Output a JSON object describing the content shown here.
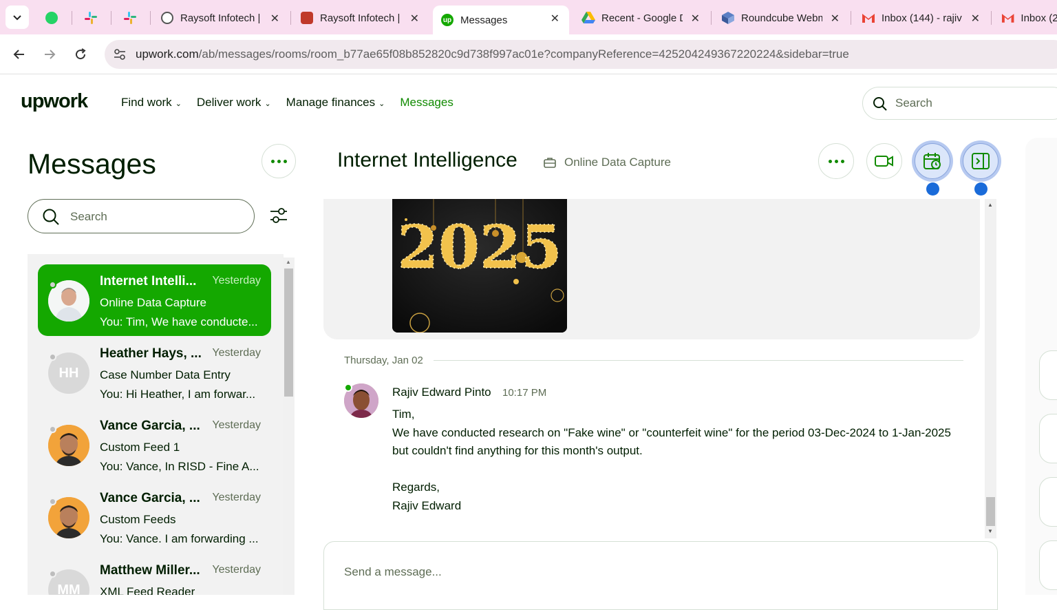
{
  "browser": {
    "tabs": [
      {
        "title": "",
        "favicon": "whatsapp-icon"
      },
      {
        "title": "",
        "favicon": "slack-icon"
      },
      {
        "title": "",
        "favicon": "slack-icon"
      },
      {
        "title": "Raysoft Infotech |",
        "favicon": "globe-icon"
      },
      {
        "title": "Raysoft Infotech |",
        "favicon": "raysoft-icon"
      },
      {
        "title": "Messages",
        "favicon": "upwork-icon",
        "active": true
      },
      {
        "title": "Recent - Google D",
        "favicon": "google-drive-icon"
      },
      {
        "title": "Roundcube Webm",
        "favicon": "roundcube-icon"
      },
      {
        "title": "Inbox (144) - rajiv",
        "favicon": "gmail-icon"
      },
      {
        "title": "Inbox (2",
        "favicon": "gmail-icon"
      }
    ],
    "url_host": "upwork.com",
    "url_path": "/ab/messages/rooms/room_b77ae65f08b852820c9d738f997ac01e?companyReference=425204249367220224&sidebar=true"
  },
  "header": {
    "logo": "upwork",
    "nav": [
      {
        "label": "Find work",
        "has_menu": true
      },
      {
        "label": "Deliver work",
        "has_menu": true
      },
      {
        "label": "Manage finances",
        "has_menu": true
      },
      {
        "label": "Messages",
        "has_menu": false,
        "active": true
      }
    ],
    "search_placeholder": "Search"
  },
  "sidebar": {
    "title": "Messages",
    "search_placeholder": "Search",
    "rooms": [
      {
        "name": "Internet Intelli...",
        "time": "Yesterday",
        "subtitle": "Online Data Capture",
        "preview": "You: Tim, We have conducte...",
        "avatar": "photo",
        "active": true
      },
      {
        "name": "Heather Hays, ...",
        "time": "Yesterday",
        "subtitle": "Case Number Data Entry",
        "preview": "You: Hi Heather, I am forwar...",
        "avatar_initials": "HH"
      },
      {
        "name": "Vance Garcia, ...",
        "time": "Yesterday",
        "subtitle": "Custom Feed 1",
        "preview": "You: Vance, In RISD - Fine A...",
        "avatar": "photo"
      },
      {
        "name": "Vance Garcia, ...",
        "time": "Yesterday",
        "subtitle": "Custom Feeds",
        "preview": "You: Vance. I am forwarding ...",
        "avatar": "photo"
      },
      {
        "name": "Matthew Miller...",
        "time": "Yesterday",
        "subtitle": "XML Feed Reader",
        "preview": "",
        "avatar_initials": "MM"
      }
    ]
  },
  "chat": {
    "title": "Internet Intelligence",
    "contract": "Online Data Capture",
    "image_text": "2025",
    "date_divider": "Thursday, Jan 02",
    "message": {
      "author": "Rajiv Edward Pinto",
      "time": "10:17 PM",
      "lines": [
        "Tim,",
        "We have conducted research on \"Fake wine\" or \"counterfeit wine\" for the period 03-Dec-2024 to 1-Jan-2025 but couldn't find anything for this month's output.",
        "",
        "Regards,",
        "Rajiv Edward"
      ]
    },
    "composer_placeholder": "Send a message..."
  },
  "colors": {
    "brand_green": "#14a800",
    "active_nav": "#108a00",
    "tab_strip": "#f9dff0",
    "highlight_blue": "#1a6bd9"
  }
}
